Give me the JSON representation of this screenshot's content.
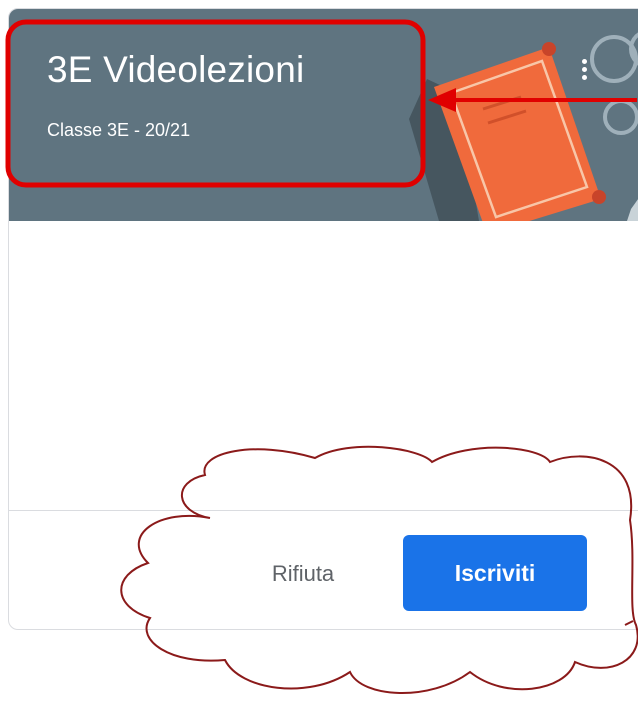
{
  "class_card": {
    "title": "3E Videolezioni",
    "subtitle": "Classe 3E - 20/21",
    "banner_color": "#5f7480",
    "menu_icon": "more-vert-icon"
  },
  "actions": {
    "decline_label": "Rifiuta",
    "join_label": "Iscriviti",
    "join_color": "#1a73e8"
  },
  "annotations": {
    "highlight_color": "#e00000",
    "cloud_outline_color": "#8b1a1a"
  }
}
